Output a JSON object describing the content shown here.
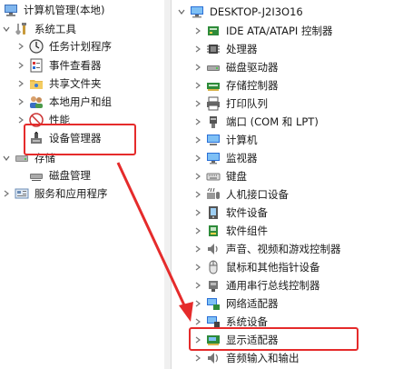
{
  "left_tree": {
    "root": "计算机管理(本地)",
    "system_tools": "系统工具",
    "task_scheduler": "任务计划程序",
    "event_viewer": "事件查看器",
    "shared_folders": "共享文件夹",
    "local_users": "本地用户和组",
    "performance": "性能",
    "device_manager": "设备管理器",
    "storage": "存储",
    "disk_management": "磁盘管理",
    "services_apps": "服务和应用程序"
  },
  "right_tree": {
    "computer_name": "DESKTOP-J2I3O16",
    "items": [
      "IDE ATA/ATAPI 控制器",
      "处理器",
      "磁盘驱动器",
      "存储控制器",
      "打印队列",
      "端口 (COM 和 LPT)",
      "计算机",
      "监视器",
      "键盘",
      "人机接口设备",
      "软件设备",
      "软件组件",
      "声音、视频和游戏控制器",
      "鼠标和其他指针设备",
      "通用串行总线控制器",
      "网络适配器",
      "系统设备",
      "显示适配器",
      "音频输入和输出"
    ]
  },
  "colors": {
    "highlight": "#e52b2b",
    "icon_blue": "#1e78d2",
    "icon_green": "#2e8b3a"
  }
}
